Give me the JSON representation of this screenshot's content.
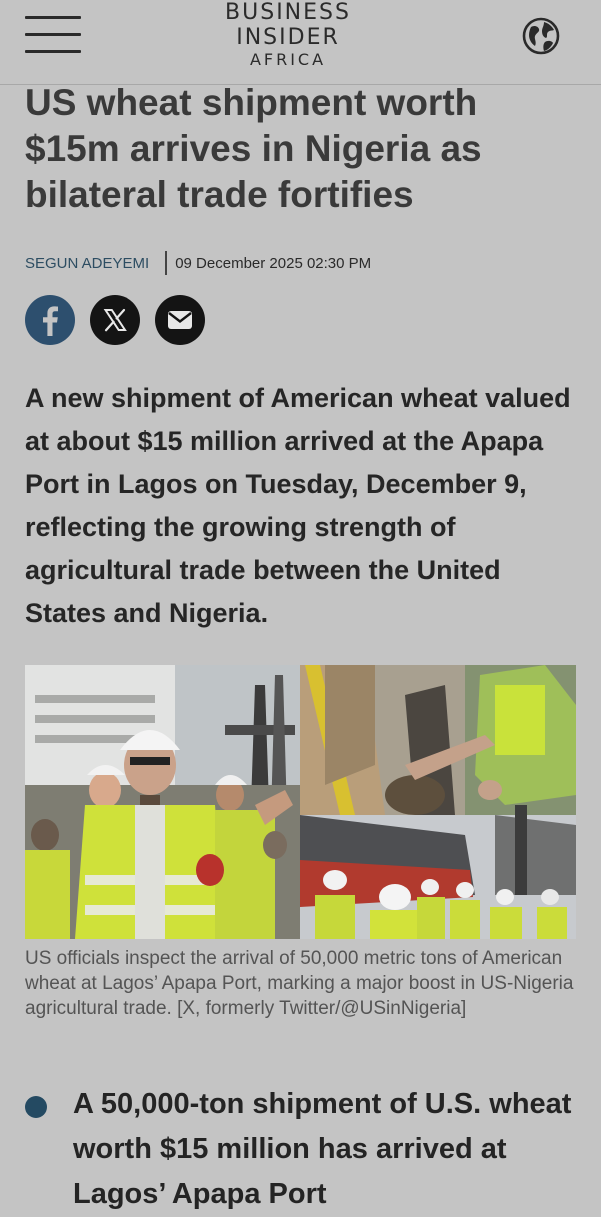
{
  "header": {
    "logo_line1": "BUSINESS",
    "logo_line2": "INSIDER",
    "logo_line3": "AFRICA",
    "menu_icon": "hamburger-menu-icon",
    "edition_icon": "globe-icon"
  },
  "article": {
    "headline": "US wheat shipment worth $15m arrives in Nigeria as bilateral trade fortifies",
    "author": "SEGUN ADEYEMI",
    "date": "09 December 2025 02:30 PM",
    "lede": "A new shipment of American wheat valued at about $15 million arrived at the Apapa Port in Lagos on Tuesday, December 9, reflecting the growing strength of agricultural trade between the United States and Nigeria.",
    "image_caption": "US officials inspect the arrival of 50,000 metric tons of American wheat at Lagos’ Apapa Port, marking a major boost in US-Nigeria agricultural trade. [X, formerly Twitter/@USinNigeria]",
    "bullets": [
      "A 50,000-ton shipment of U.S. wheat worth $15 million has arrived at Lagos’ Apapa Port"
    ]
  },
  "share": {
    "icons": [
      "facebook-icon",
      "x-icon",
      "email-icon"
    ]
  },
  "colors": {
    "background": "#c4c4c4",
    "accent": "#244a62",
    "headline": "#3a3a3a"
  }
}
